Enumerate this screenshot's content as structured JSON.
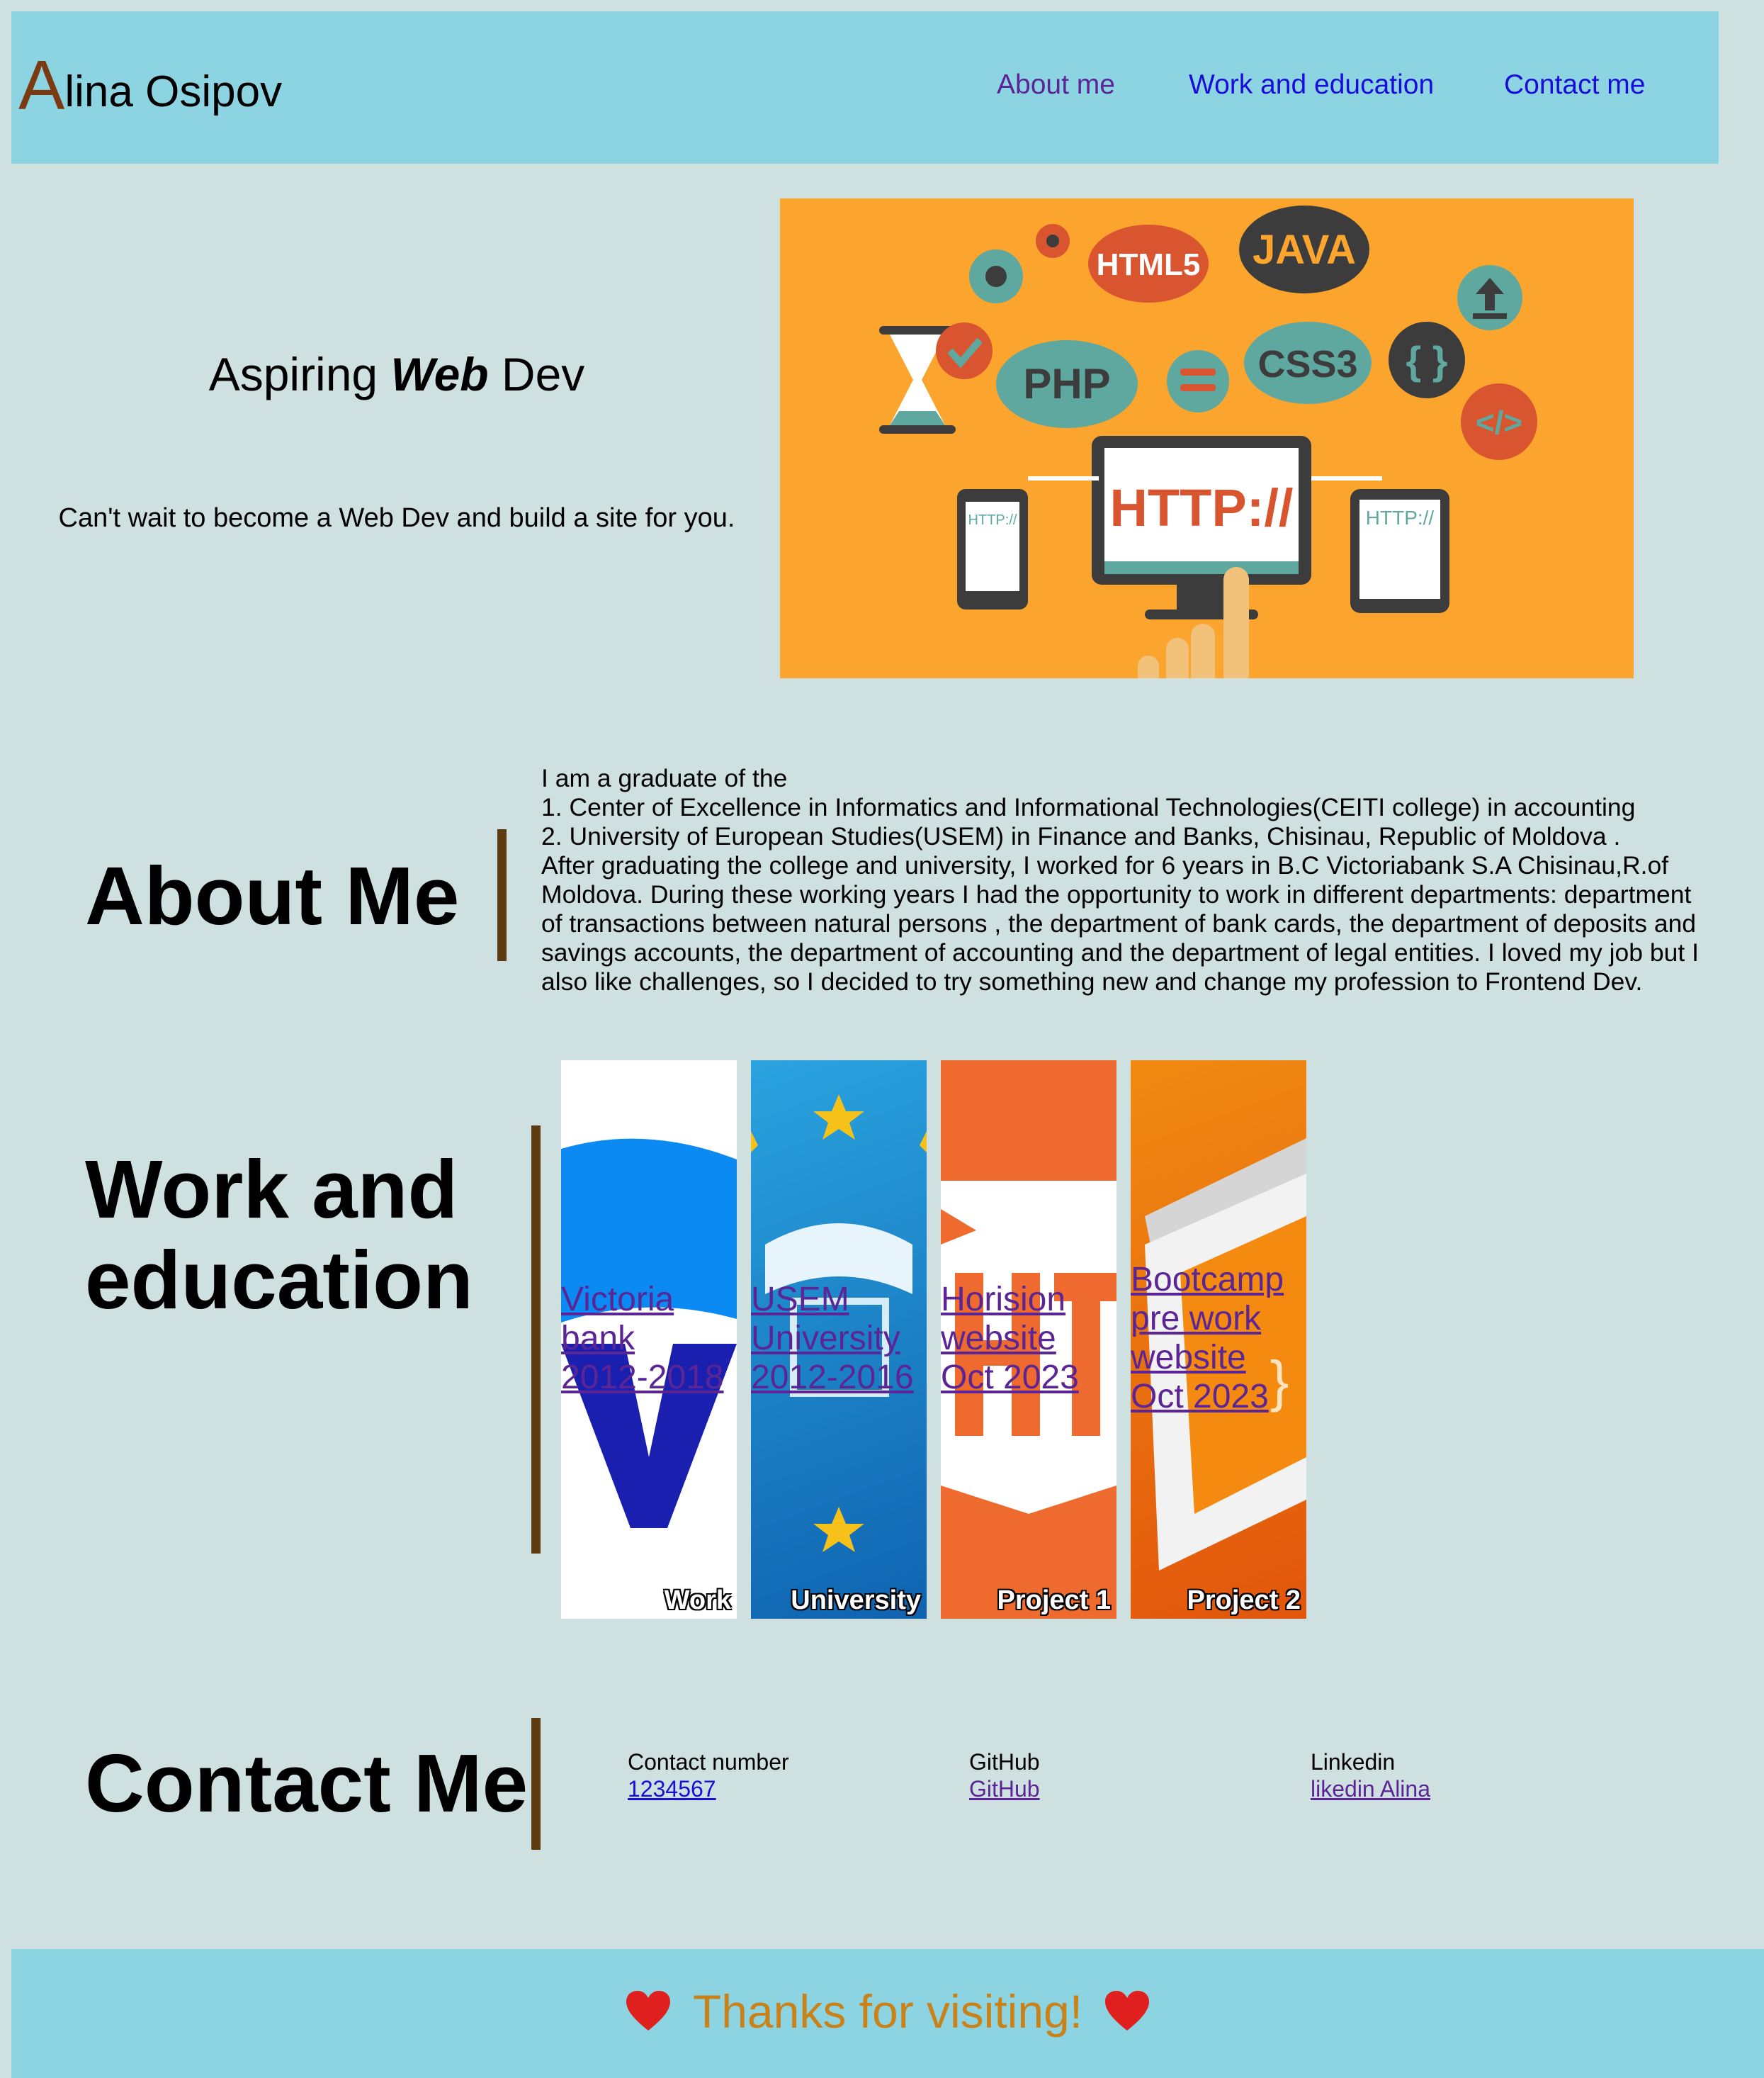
{
  "header": {
    "logo_first": "A",
    "logo_rest": "lina Osipov",
    "nav": [
      "About me",
      "Work and education",
      "Contact me"
    ]
  },
  "hero": {
    "title_pre": "Aspiring ",
    "title_em": "Web",
    "title_post": " Dev",
    "subtitle": "Can't wait to become a Web Dev and build a site for you.",
    "image_words": [
      "HTML5",
      "JAVA",
      "PHP",
      "CSS3",
      "HTTP://",
      "HTTP://",
      "HTTP://",
      "</>",
      "{ }"
    ]
  },
  "about": {
    "title": "About Me",
    "lines": [
      "I am a graduate of the",
      "1. Center of Excellence in Informatics and Informational Technologies(CEITI college) in accounting",
      "2. University of European Studies(USEM) in Finance and Banks, Chisinau, Republic of Moldova .",
      "After graduating the college and university, I worked for 6 years in B.C Victoriabank S.A Chisinau,R.of",
      "Moldova. During these working years I had the opportunity to work in different departments: department",
      "of transactions between natural persons , the department of bank cards, the department of deposits and",
      "savings accounts, the department of accounting and the department of legal entities. I loved my job but I",
      "also like challenges, so I decided to try something new and change my profession to Frontend Dev."
    ]
  },
  "work": {
    "title_line1": "Work and",
    "title_line2": "education",
    "cards": [
      {
        "lines": [
          "Victoria",
          "bank",
          "2012-2018"
        ],
        "label": "Work"
      },
      {
        "lines": [
          "USEM",
          "University",
          "2012-2016"
        ],
        "label": "University"
      },
      {
        "lines": [
          "Horision",
          "website",
          "Oct 2023"
        ],
        "label": "Project 1"
      },
      {
        "lines": [
          "Bootcamp",
          "pre work",
          "website",
          "Oct 2023"
        ],
        "label": "Project 2"
      }
    ]
  },
  "contact": {
    "title": "Contact Me",
    "items": [
      {
        "label": "Contact number",
        "link": "1234567"
      },
      {
        "label": "GitHub",
        "link": "GitHub"
      },
      {
        "label": "Linkedin",
        "link": "likedin Alina"
      }
    ]
  },
  "footer": {
    "text": "Thanks for visiting!"
  },
  "colors": {
    "background": "#cfe0e1",
    "header": "#8dd4e3",
    "accent_bar": "#5c3c10",
    "footer_text": "#c9821a",
    "link": "#1a0dd8",
    "visited_link": "#5b2595"
  }
}
